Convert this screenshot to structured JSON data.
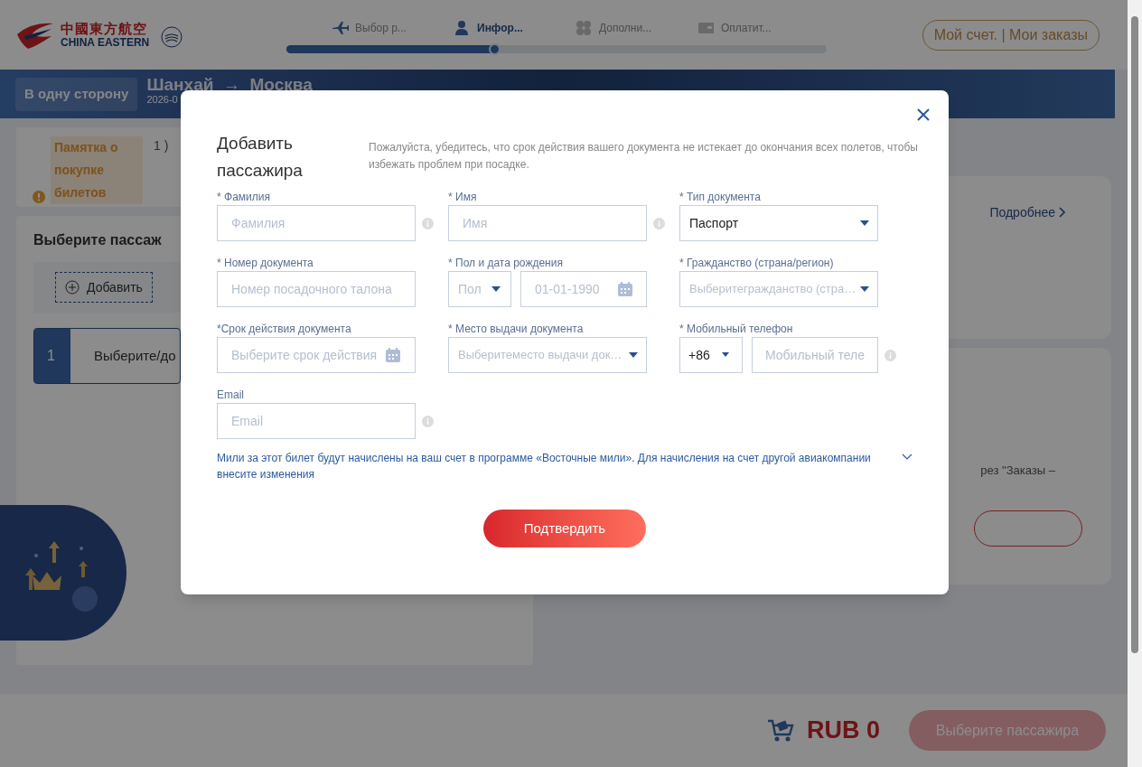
{
  "header": {
    "logo": {
      "chinese": "中國東方航空",
      "english": "CHINA EASTERN"
    },
    "steps": [
      {
        "label": "Выбор р...",
        "kind": "plane",
        "selected": false
      },
      {
        "label": "Инфор...",
        "kind": "person",
        "selected": true
      },
      {
        "label": "Дополни...",
        "kind": "grid",
        "selected": false
      },
      {
        "label": "Оплатит...",
        "kind": "wallet",
        "selected": false
      }
    ],
    "progress": {
      "level": 0.385
    },
    "account_button": "Мой счет. | Мои заказы"
  },
  "trip_bar": {
    "trip_type": "В одну сторону",
    "route": "Шанхай  →  Москва",
    "date": "2026-0"
  },
  "notice": {
    "title": "Памятка о покупке билетов",
    "text": "1 )"
  },
  "passengers": {
    "title": "Выберите пассаж",
    "add_button": "Добавить",
    "rows": [
      {
        "index": "1",
        "text": "Выберите/до"
      }
    ]
  },
  "side": {
    "more_link": "Подробнее",
    "note": "рез \"Заказы –"
  },
  "bottom_bar": {
    "currency_total": "RUB 0",
    "submit": "Выберите пассажира"
  },
  "dialog": {
    "title": "Добавить пассажира",
    "hint": "Пожалуйста, убедитесь, что срок действия вашего документа не истекает до окончания всех полетов, чтобы избежать проблем при посадке.",
    "fields": [
      {
        "kind": "text",
        "label": "* Фамилия",
        "placeholder": "Фамилия",
        "info": true
      },
      {
        "kind": "text",
        "label": "* Имя",
        "placeholder": "Имя",
        "info": true
      },
      {
        "kind": "select",
        "label": "* Тип документа",
        "value": "Паспорт"
      },
      {
        "kind": "text",
        "label": "* Номер документа",
        "placeholder": "Номер посадочного талона",
        "info": false
      },
      {
        "kind": "gender_date",
        "label": "* Пол и дата рождения",
        "gender_placeholder": "Пол",
        "date_placeholder": "01-01-1990"
      },
      {
        "kind": "select",
        "label": "* Гражданство (страна/регион)",
        "placeholder": "Выберитегражданство (стра…"
      },
      {
        "kind": "date",
        "label": "*Срок действия документа",
        "placeholder": "Выберите срок действия"
      },
      {
        "kind": "select",
        "label": "* Место выдачи документа",
        "placeholder": "Выберитеместо выдачи док…"
      },
      {
        "kind": "phone",
        "label": "* Мобильный телефон",
        "code": "+86",
        "placeholder": "Мобильный теле",
        "info": true
      },
      {
        "kind": "text",
        "label": "Email",
        "placeholder": "Email",
        "info": true
      }
    ],
    "miles_note": "Мили за этот билет будут начислены на ваш счет в программе «Восточные мили». Для начисления на счет другой авиакомпании внесите изменения",
    "confirm": "Подтвердить"
  }
}
